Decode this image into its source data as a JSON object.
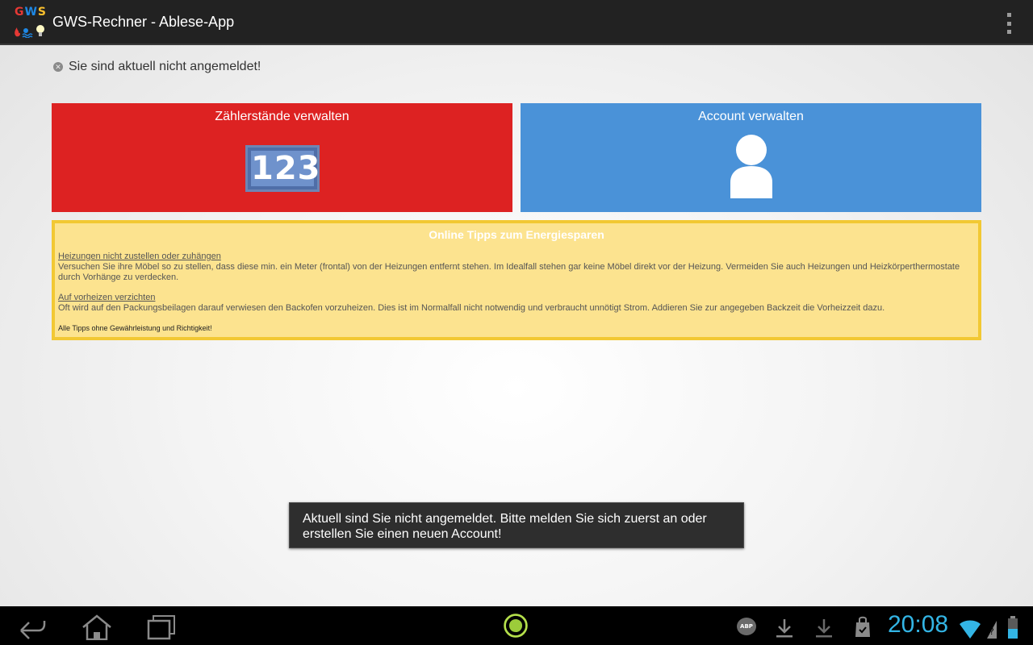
{
  "app": {
    "title": "GWS-Rechner - Ablese-App",
    "logo_letters": [
      "G",
      "W",
      "S"
    ]
  },
  "status": {
    "text": "Sie sind aktuell nicht angemeldet!"
  },
  "tiles": {
    "meter": {
      "label": "Zählerstände verwalten",
      "icon_text": "123",
      "color": "#dd2222"
    },
    "account": {
      "label": "Account verwalten",
      "color": "#4a92d8"
    }
  },
  "tips": {
    "title": "Online Tipps zum Energiesparen",
    "items": [
      {
        "heading": "Heizungen nicht zustellen oder zuhängen",
        "text": "Versuchen Sie ihre Möbel so zu stellen, dass diese min. ein Meter (frontal) von der Heizungen entfernt stehen. Im Idealfall stehen gar keine Möbel direkt vor der Heizung. Vermeiden Sie auch Heizungen und Heizkörperthermostate durch Vorhänge zu verdecken."
      },
      {
        "heading": "Auf vorheizen verzichten",
        "text": "Oft wird auf den Packungsbeilagen darauf verwiesen den Backofen vorzuheizen. Dies ist im Normalfall nicht notwendig und verbraucht unnötigt Strom. Addieren Sie zur angegeben Backzeit die Vorheizzeit dazu."
      }
    ],
    "disclaimer": "Alle Tipps ohne Gewährleistung und Richtigkeit!"
  },
  "toast": {
    "message": "Aktuell sind Sie nicht angemeldet. Bitte melden Sie sich zuerst an oder erstellen Sie einen neuen Account!"
  },
  "system_bar": {
    "clock": "20:08",
    "abp_label": "ABP",
    "accent_color": "#33b5e5"
  }
}
